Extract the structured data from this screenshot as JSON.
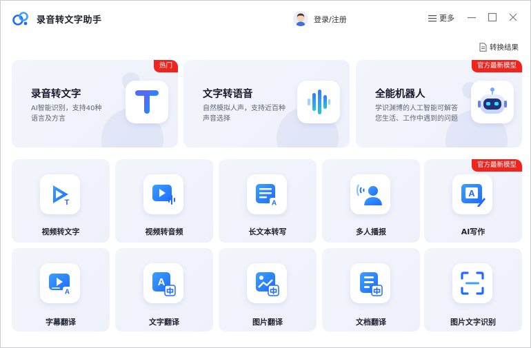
{
  "app": {
    "title": "录音转文字助手"
  },
  "header": {
    "login_label": "登录/注册",
    "more_label": "更多"
  },
  "result_link": "转换结果",
  "colors": {
    "accent": "#1f6bff",
    "badge": "#f0231e",
    "card_bg": "#f2f4fb"
  },
  "feature_cards": [
    {
      "title": "录音转文字",
      "desc": "AI智能识别，支持40种语言及方言",
      "badge": "热门",
      "icon": "t-letter-icon"
    },
    {
      "title": "文字转语音",
      "desc": "自然模拟人声，支持近百种声音选择",
      "badge": "",
      "icon": "sound-wave-icon"
    },
    {
      "title": "全能机器人",
      "desc": "学识渊博的人工智能可解答您生活、工作中遇到的问题",
      "badge": "官方最新模型",
      "icon": "robot-icon"
    }
  ],
  "tools": [
    {
      "label": "视频转文字",
      "icon": "video-to-text-icon",
      "badge": ""
    },
    {
      "label": "视频转音频",
      "icon": "video-to-audio-icon",
      "badge": ""
    },
    {
      "label": "长文本转写",
      "icon": "long-text-icon",
      "badge": ""
    },
    {
      "label": "多人播报",
      "icon": "multi-voice-icon",
      "badge": ""
    },
    {
      "label": "AI写作",
      "icon": "ai-writing-icon",
      "badge": "官方最新模型"
    },
    {
      "label": "字幕翻译",
      "icon": "subtitle-translate-icon",
      "badge": ""
    },
    {
      "label": "文字翻译",
      "icon": "text-translate-icon",
      "badge": ""
    },
    {
      "label": "图片翻译",
      "icon": "image-translate-icon",
      "badge": ""
    },
    {
      "label": "文档翻译",
      "icon": "document-translate-icon",
      "badge": ""
    },
    {
      "label": "图片文字识别",
      "icon": "ocr-scan-icon",
      "badge": ""
    }
  ]
}
